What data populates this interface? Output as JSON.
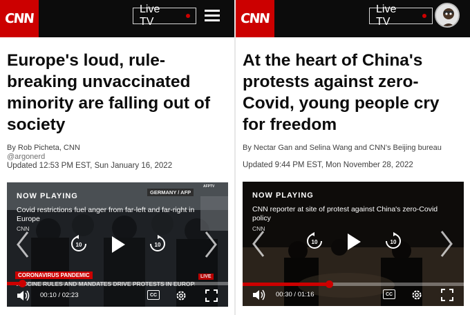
{
  "left": {
    "logo": "CNN",
    "live_tv_label": "Live TV",
    "headline": "Europe's loud, rule-breaking unvaccinated minority are falling out of society",
    "byline": "By Rob Picheta, CNN",
    "handle": "@argonerd",
    "updated": "Updated 12:53 PM EST, Sun January 16, 2022",
    "video": {
      "now_playing": "NOW PLAYING",
      "title": "Covid restrictions fuel anger from far-left and far-right in Europe",
      "source": "CNN",
      "watermark": "GERMANY / AFP",
      "watermark_top": "AFPTV",
      "lower_third": "CORONAVIRUS PANDEMIC",
      "ticker": "VACCINE RULES AND MANDATES DRIVE PROTESTS IN EUROPE",
      "live_badge": "LIVE",
      "current_time": "00:10",
      "duration": "02:23",
      "progress_fraction": 0.07,
      "cc_label": "CC",
      "rewind_seconds": "10",
      "forward_seconds": "10"
    }
  },
  "right": {
    "logo": "CNN",
    "live_tv_label": "Live TV",
    "headline": "At the heart of China's protests against zero-Covid, young people cry for freedom",
    "byline": "By Nectar Gan and Selina Wang and CNN's Beijing bureau",
    "updated": "Updated 9:44 PM EST, Mon November 28, 2022",
    "video": {
      "now_playing": "NOW PLAYING",
      "title": "CNN reporter at site of protest against China's zero-Covid policy",
      "source": "CNN",
      "current_time": "00:30",
      "duration": "01:16",
      "progress_fraction": 0.39,
      "cc_label": "CC",
      "rewind_seconds": "10",
      "forward_seconds": "10"
    }
  },
  "colors": {
    "brand_red": "#cc0000",
    "header_black": "#0c0c0c",
    "text": "#0c0c0c",
    "meta_text": "#404040"
  },
  "icons": [
    "menu-icon",
    "live-dot-icon",
    "chevron-left-icon",
    "chevron-right-icon",
    "rewind-10-icon",
    "play-icon",
    "forward-10-icon",
    "volume-icon",
    "settings-gear-icon",
    "fullscreen-icon",
    "avatar"
  ]
}
